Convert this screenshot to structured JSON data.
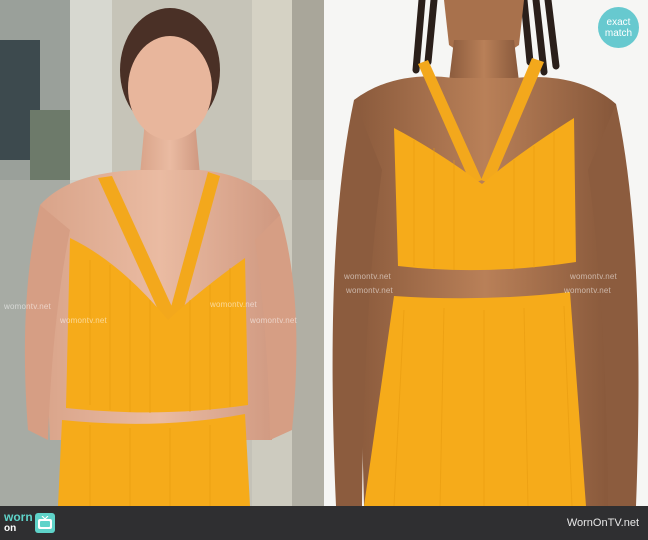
{
  "badge": {
    "line1": "exact",
    "line2": "match"
  },
  "watermark": {
    "text": "womontv.net"
  },
  "footer": {
    "logo_top": "worn",
    "logo_bottom": "on",
    "logo_icon": "tv-icon",
    "site": "WornOnTV.net"
  },
  "colors": {
    "garment": "#f6ab1a",
    "badge": "#67c9cf",
    "footer": "#2f2f31",
    "logo_accent": "#5fd3c9"
  }
}
